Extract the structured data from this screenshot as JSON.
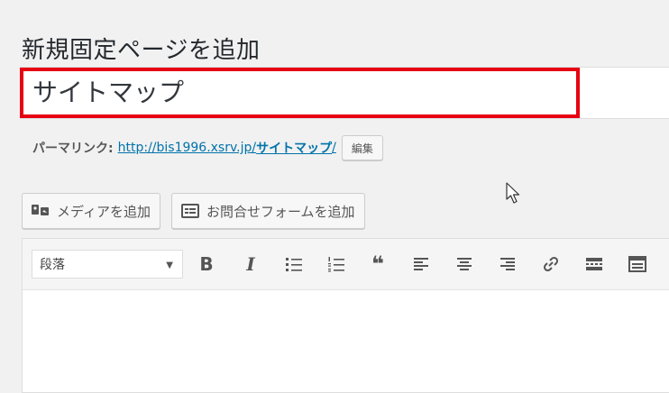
{
  "page": {
    "title": "新規固定ページを追加"
  },
  "title_field": {
    "value": "サイトマップ"
  },
  "permalink": {
    "label": "パーマリンク:",
    "base_url": "http://bis1996.xsrv.jp/",
    "slug": "サイトマップ",
    "trailing": "/",
    "edit_label": "編集"
  },
  "media_buttons": {
    "add_media": "メディアを追加",
    "add_contact_form": "お問合せフォームを追加"
  },
  "editor": {
    "format_select": "段落",
    "toolbar_icons": [
      "bold-icon",
      "italic-icon",
      "bullet-list-icon",
      "numbered-list-icon",
      "blockquote-icon",
      "align-left-icon",
      "align-center-icon",
      "align-right-icon",
      "link-icon",
      "more-tag-icon",
      "toolbar-toggle-icon"
    ],
    "bold_glyph": "B",
    "italic_glyph": "I",
    "quote_glyph": "❝",
    "content": ""
  },
  "colors": {
    "highlight": "#e60012",
    "link": "#0073aa",
    "background": "#f1f1f1"
  }
}
